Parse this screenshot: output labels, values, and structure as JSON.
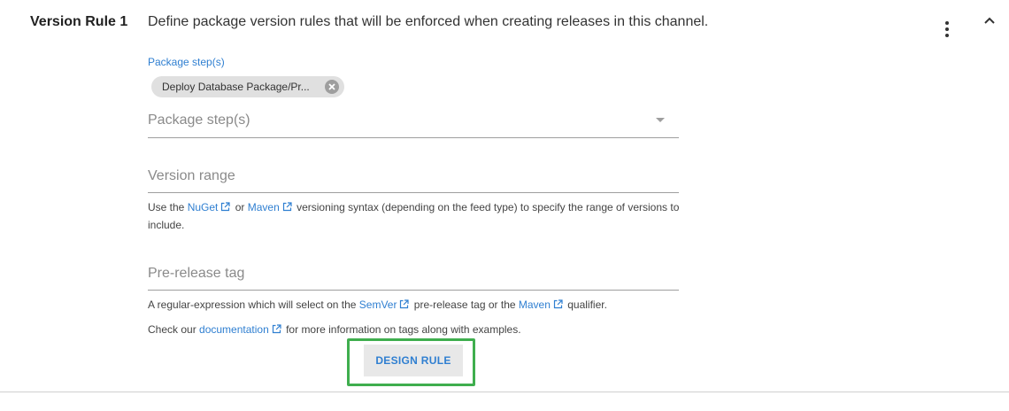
{
  "rule": {
    "title": "Version Rule 1",
    "description": "Define package version rules that will be enforced when creating releases in this channel."
  },
  "package_steps": {
    "label": "Package step(s)",
    "chip_text": "Deploy Database Package/Pr...",
    "placeholder": "Package step(s)"
  },
  "version_range": {
    "placeholder": "Version range",
    "help": {
      "t1": "Use the ",
      "link1": "NuGet",
      "t2": " or ",
      "link2": "Maven",
      "t3": " versioning syntax (depending on the feed type) to specify the range of versions to include."
    }
  },
  "prerelease_tag": {
    "placeholder": "Pre-release tag",
    "help": {
      "t1": "A regular-expression which will select on the ",
      "link1": "SemVer",
      "t2": " pre-release tag or the ",
      "link2": "Maven",
      "t3": " qualifier."
    },
    "doc": {
      "t1": "Check our ",
      "link": "documentation",
      "t2": " for more information on tags along with examples."
    }
  },
  "design_button_label": "DESIGN RULE",
  "colors": {
    "link": "#2f7fd1",
    "highlight": "#3fae4e",
    "chip_bg": "#e0e0e0"
  },
  "icons": {
    "menu": "more-vert-icon",
    "collapse": "chevron-up-icon",
    "chip_remove": "cancel-icon",
    "dropdown": "arrow-drop-down-icon",
    "external": "external-link-icon"
  }
}
